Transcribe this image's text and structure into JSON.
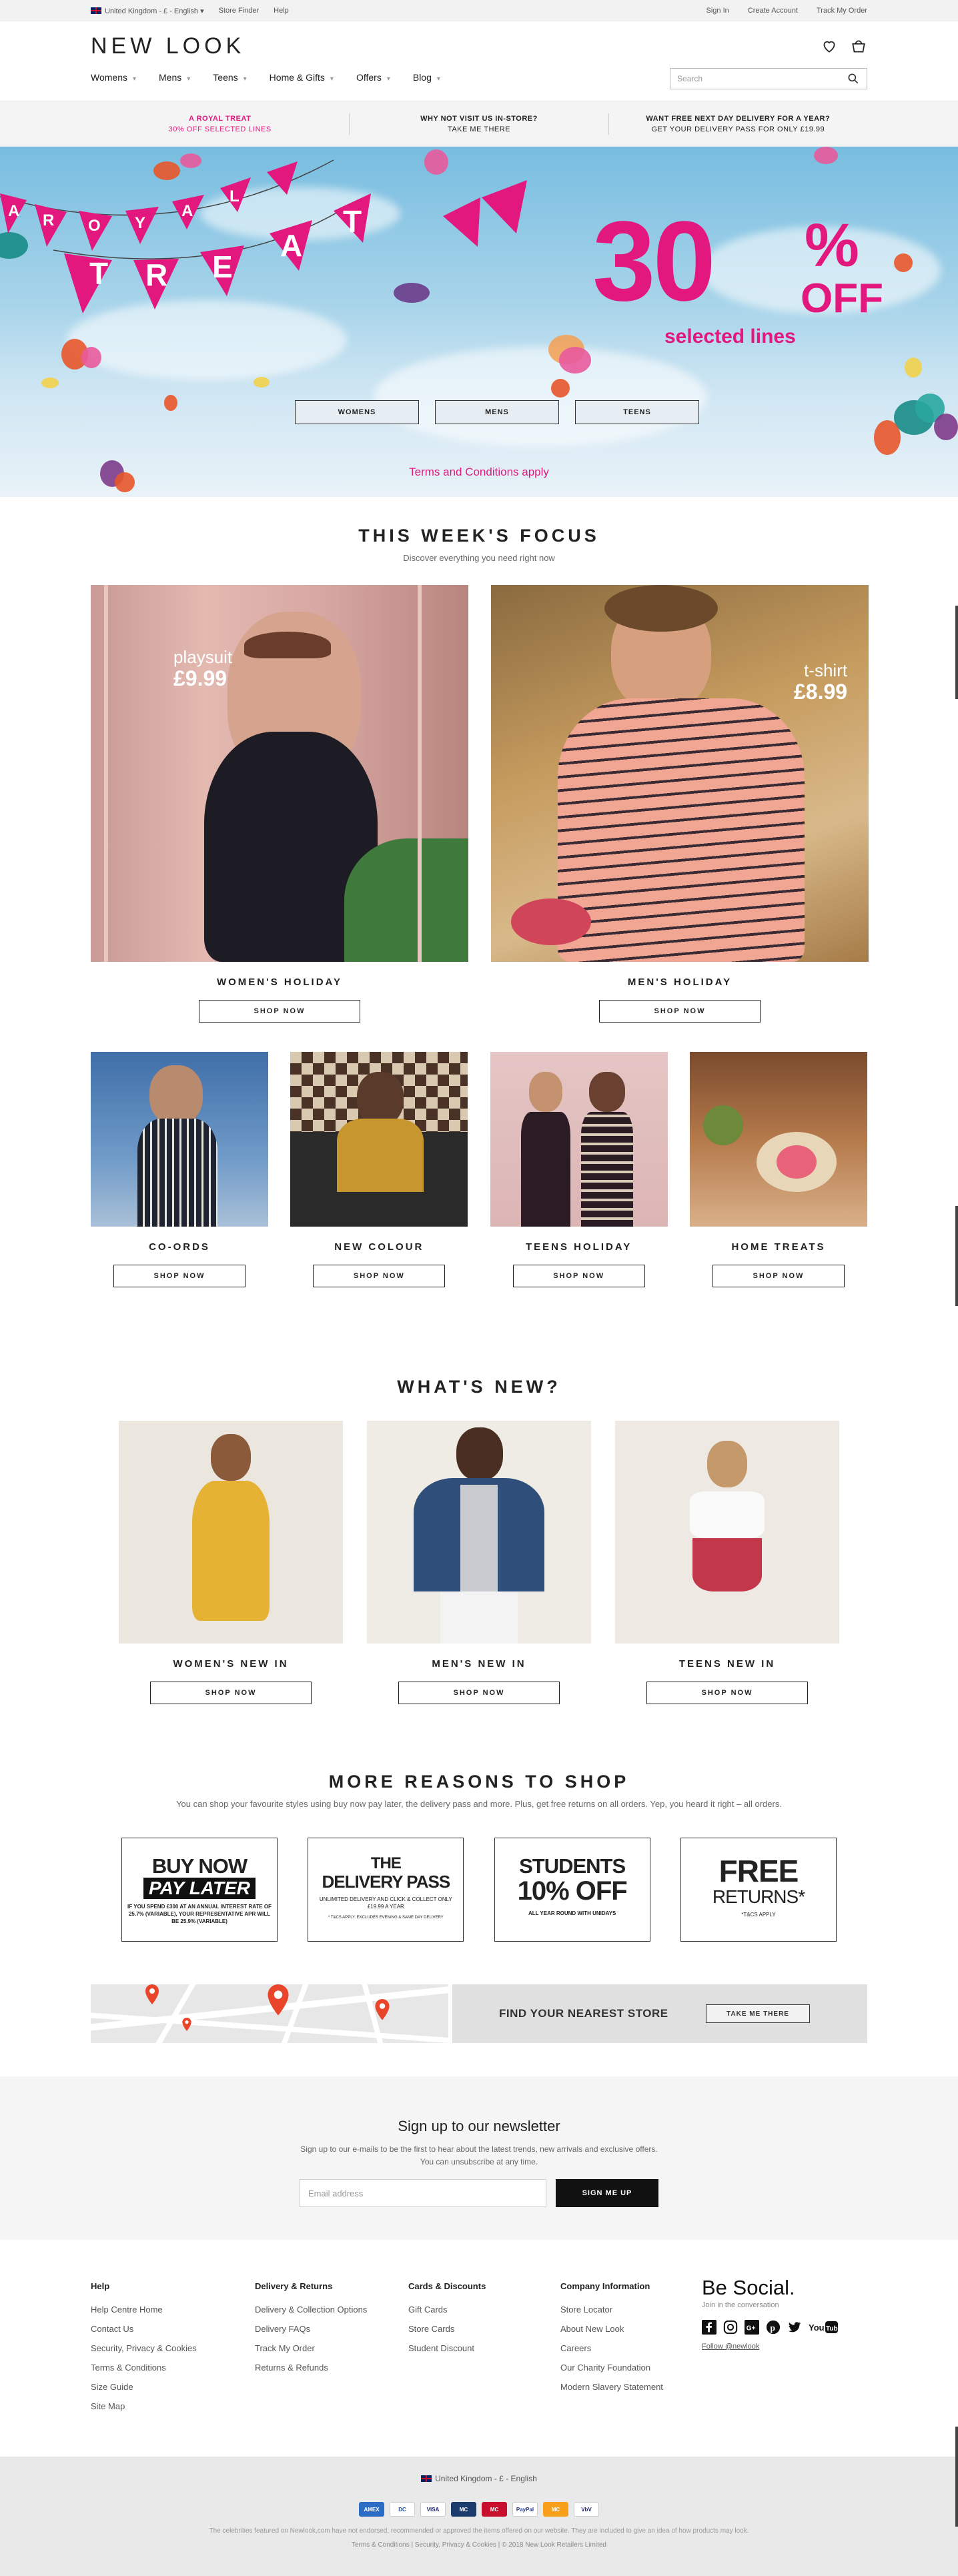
{
  "topbar": {
    "locale": "United Kingdom - £ - English",
    "store_finder": "Store Finder",
    "help": "Help",
    "sign_in": "Sign In",
    "create_account": "Create Account",
    "track_order": "Track My Order"
  },
  "header": {
    "logo": "NEW LOOK",
    "nav": [
      "Womens",
      "Mens",
      "Teens",
      "Home & Gifts",
      "Offers",
      "Blog"
    ],
    "search_placeholder": "Search"
  },
  "promo": [
    {
      "title": "A ROYAL TREAT",
      "sub": "30% OFF SELECTED LINES"
    },
    {
      "title": "WHY NOT VISIT US IN-STORE?",
      "sub": "TAKE ME THERE"
    },
    {
      "title": "WANT FREE NEXT DAY DELIVERY FOR A YEAR?",
      "sub": "GET YOUR DELIVERY PASS FOR ONLY £19.99"
    }
  ],
  "hero": {
    "flags": [
      "A",
      "R",
      "O",
      "Y",
      "A",
      "L",
      "T",
      "R",
      "E",
      "A",
      "T"
    ],
    "percent": "30",
    "symbol": "%",
    "off": "OFF",
    "sub": "selected lines",
    "buttons": [
      "WOMENS",
      "MENS",
      "TEENS"
    ],
    "terms": "Terms and Conditions apply",
    "colors": {
      "pink": "#e2187e",
      "sky": "#8cc8e6"
    }
  },
  "focus": {
    "title": "THIS WEEK'S FOCUS",
    "sub": "Discover everything you need right now",
    "big": [
      {
        "title": "WOMEN'S HOLIDAY",
        "label": "playsuit",
        "price": "£9.99",
        "button": "SHOP NOW"
      },
      {
        "title": "MEN'S HOLIDAY",
        "label": "t-shirt",
        "price": "£8.99",
        "button": "SHOP NOW"
      }
    ],
    "small": [
      {
        "title": "CO-ORDS",
        "button": "SHOP NOW"
      },
      {
        "title": "NEW COLOUR",
        "button": "SHOP NOW"
      },
      {
        "title": "TEENS HOLIDAY",
        "button": "SHOP NOW"
      },
      {
        "title": "HOME TREATS",
        "button": "SHOP NOW"
      }
    ]
  },
  "whats_new": {
    "title": "WHAT'S NEW?",
    "cards": [
      {
        "title": "WOMEN'S NEW IN",
        "button": "SHOP NOW"
      },
      {
        "title": "MEN'S NEW IN",
        "button": "SHOP NOW"
      },
      {
        "title": "TEENS NEW IN",
        "button": "SHOP NOW"
      }
    ]
  },
  "reasons": {
    "title": "MORE REASONS TO SHOP",
    "sub": "You can shop your favourite styles using buy now pay later, the delivery pass and more. Plus, get free returns on all orders. Yep, you heard it right – all orders.",
    "boxes": [
      {
        "l1": "BUY NOW",
        "l2": "PAY LATER",
        "small": "IF YOU SPEND £300 AT AN ANNUAL INTEREST RATE OF 25.7% (VARIABLE), YOUR REPRESENTATIVE APR WILL BE 25.9% (VARIABLE)"
      },
      {
        "l1": "THE",
        "l2": "DELIVERY PASS",
        "small": "UNLIMITED DELIVERY AND CLICK & COLLECT ONLY £19.99 A YEAR",
        "small2": "* T&CS APPLY. EXCLUDES EVENING & SAME DAY DELIVERY"
      },
      {
        "l1": "STUDENTS",
        "l2": "10% OFF",
        "small": "ALL YEAR ROUND WITH UNIDAYS"
      },
      {
        "l1": "FREE",
        "l2": "RETURNS*",
        "small": "*T&CS APPLY"
      }
    ],
    "store": {
      "find": "FIND YOUR NEAREST STORE",
      "take": "TAKE ME THERE"
    }
  },
  "newsletter": {
    "title": "Sign up to our newsletter",
    "line1": "Sign up to our e-mails to be the first to hear about the latest trends, new arrivals and exclusive offers.",
    "line2": "You can unsubscribe at any time.",
    "placeholder": "Email address",
    "button": "SIGN ME UP"
  },
  "footer": {
    "cols": [
      {
        "title": "Help",
        "links": [
          "Help Centre Home",
          "Contact Us",
          "Security, Privacy & Cookies",
          "Terms & Conditions",
          "Size Guide",
          "Site Map"
        ]
      },
      {
        "title": "Delivery & Returns",
        "links": [
          "Delivery & Collection Options",
          "Delivery FAQs",
          "Track My Order",
          "Returns & Refunds"
        ]
      },
      {
        "title": "Cards & Discounts",
        "links": [
          "Gift Cards",
          "Store Cards",
          "Student Discount"
        ]
      },
      {
        "title": "Company Information",
        "links": [
          "Store Locator",
          "About New Look",
          "Careers",
          "Our Charity Foundation",
          "Modern Slavery Statement"
        ]
      }
    ],
    "social": {
      "title": "Be Social.",
      "join": "Join in the conversation",
      "follow": "Follow @newlook",
      "icons": [
        "facebook-icon",
        "instagram-icon",
        "google-plus-icon",
        "pinterest-icon",
        "twitter-icon",
        "youtube-icon"
      ]
    },
    "locale": "United Kingdom - £ - English",
    "payments": [
      "AMEX",
      "DC",
      "VISA",
      "MC",
      "MC",
      "PayPal",
      "MC",
      "VbV"
    ],
    "legal": "The celebrities featured on Newlook.com have not endorsed, recommended or approved the items offered on our website. They are included to give an idea of how products may look.",
    "links": "Terms & Conditions  |  Security, Privacy & Cookies  |  © 2018 New Look Retailers Limited"
  }
}
